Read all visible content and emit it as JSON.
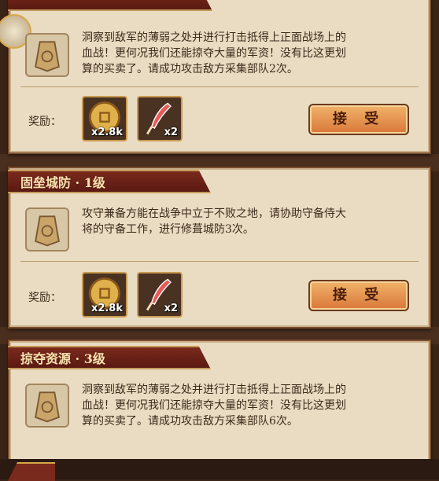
{
  "reward_label": "奖励：",
  "accept_label": "接 受",
  "quests": [
    {
      "title": "",
      "description_lines": [
        "洞察到敌军的薄弱之处并进行打击抵得上正面战场上的",
        "血战！更何况我们还能掠夺大量的军资！没有比这更划",
        "算的买卖了。请成功攻击敌方采集部队2次。"
      ],
      "rewards": [
        {
          "icon": "copper-coin-icon",
          "count": "x2.8k"
        },
        {
          "icon": "feather-brush-icon",
          "count": "x2"
        }
      ]
    },
    {
      "title": "固垒城防 · 1级",
      "description_lines": [
        "攻守兼备方能在战争中立于不败之地，请协助守备侍大",
        "将的守备工作，进行修葺城防3次。"
      ],
      "rewards": [
        {
          "icon": "copper-coin-icon",
          "count": "x2.8k"
        },
        {
          "icon": "feather-brush-icon",
          "count": "x2"
        }
      ]
    },
    {
      "title": "掠夺资源 · 3级",
      "description_lines": [
        "洞察到敌军的薄弱之处并进行打击抵得上正面战场上的",
        "血战！更何况我们还能掠夺大量的军资！没有比这更划",
        "算的买卖了。请成功攻击敌方采集部队6次。"
      ]
    }
  ],
  "colors": {
    "banner": "#7a2a1c",
    "card": "#e9dcc2",
    "button": "#e08a44"
  }
}
